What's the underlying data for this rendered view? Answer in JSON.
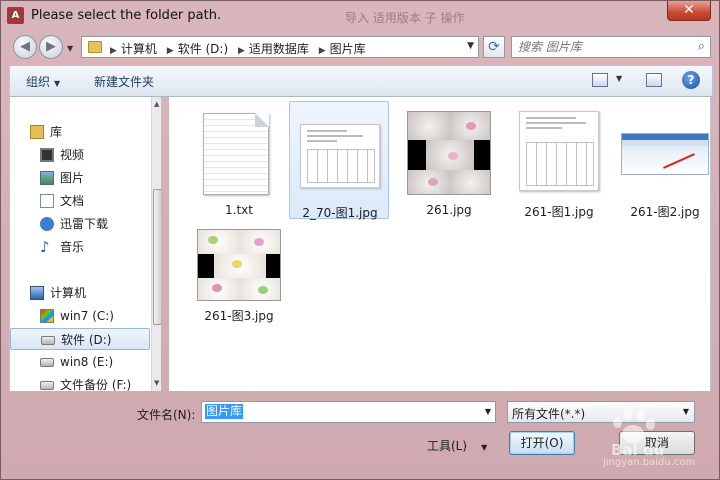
{
  "window": {
    "title": "Please select the folder path.",
    "app_icon": "A",
    "close": "✕",
    "background_title": "导入 适用版本 子 操作"
  },
  "nav": {
    "back": "◀",
    "forward": "▶"
  },
  "address": {
    "crumbs": [
      "计算机",
      "软件 (D:)",
      "适用数据库",
      "图片库"
    ]
  },
  "search": {
    "placeholder": "搜索 图片库"
  },
  "toolbar": {
    "organize": "组织",
    "new_folder": "新建文件夹",
    "help": "?"
  },
  "sidebar": {
    "items": [
      {
        "label": "库",
        "icon": "library-icon"
      },
      {
        "label": "视频",
        "icon": "video-icon"
      },
      {
        "label": "图片",
        "icon": "pictures-icon"
      },
      {
        "label": "文档",
        "icon": "documents-icon"
      },
      {
        "label": "迅雷下载",
        "icon": "download-icon"
      },
      {
        "label": "音乐",
        "icon": "music-icon"
      },
      {
        "label": "计算机",
        "icon": "computer-icon"
      },
      {
        "label": "win7 (C:)",
        "icon": "windows-drive-icon"
      },
      {
        "label": "软件 (D:)",
        "icon": "drive-icon",
        "selected": true
      },
      {
        "label": "win8 (E:)",
        "icon": "drive-icon"
      },
      {
        "label": "文件备份 (F:)",
        "icon": "drive-icon"
      }
    ]
  },
  "files": [
    {
      "name": "1.txt",
      "kind": "text"
    },
    {
      "name": "2_70-图1.jpg",
      "kind": "doc",
      "selected": true
    },
    {
      "name": "261.jpg",
      "kind": "collage"
    },
    {
      "name": "261-图1.jpg",
      "kind": "doc"
    },
    {
      "name": "261-图2.jpg",
      "kind": "screenshot"
    },
    {
      "name": "261-图3.jpg",
      "kind": "collage"
    }
  ],
  "bottom": {
    "filename_label": "文件名(N):",
    "filename_value": "图片库",
    "filetype_value": "所有文件(*.*)",
    "tools_label": "工具(L)",
    "open_label": "打开(O)",
    "cancel_label": "取消"
  },
  "watermark": {
    "text": "Bai du",
    "sub": "jingyan.baidu.com"
  }
}
